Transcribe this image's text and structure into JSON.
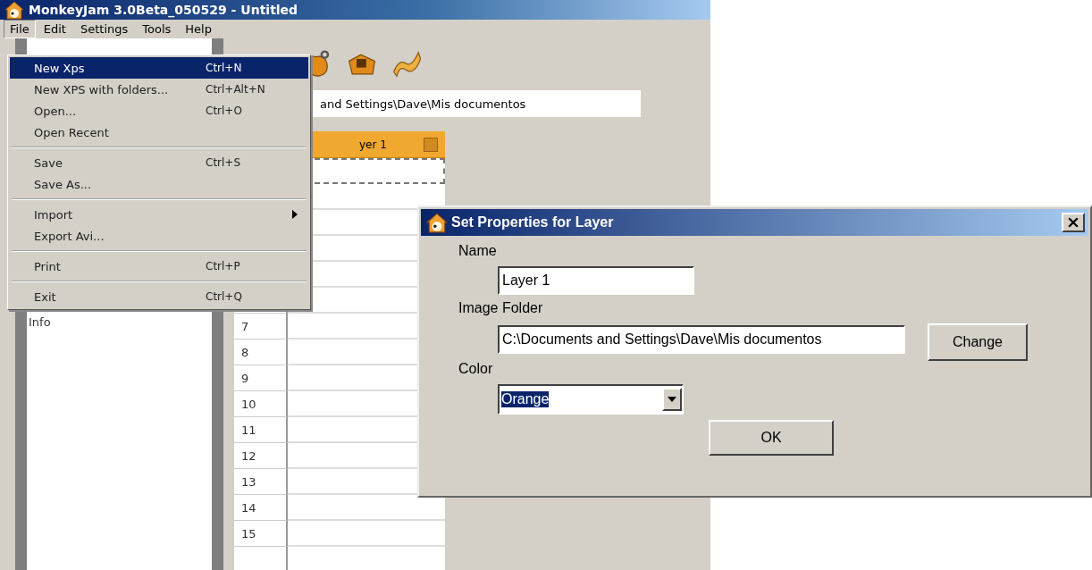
{
  "window": {
    "title": "MonkeyJam 3.0Beta_050529 - Untitled"
  },
  "menu_bar": [
    {
      "label": "File",
      "selected": true
    },
    {
      "label": "Edit",
      "selected": false
    },
    {
      "label": "Settings",
      "selected": false
    },
    {
      "label": "Tools",
      "selected": false
    },
    {
      "label": "Help",
      "selected": false
    }
  ],
  "file_menu": [
    {
      "kind": "item",
      "label": "New Xps",
      "shortcut": "Ctrl+N",
      "selected": true
    },
    {
      "kind": "item",
      "label": "New XPS with folders...",
      "shortcut": "Ctrl+Alt+N",
      "selected": false
    },
    {
      "kind": "item",
      "label": "Open...",
      "shortcut": "Ctrl+O",
      "selected": false
    },
    {
      "kind": "item",
      "label": "Open Recent",
      "selected": false
    },
    {
      "kind": "separator"
    },
    {
      "kind": "item",
      "label": "Save",
      "shortcut": "Ctrl+S",
      "selected": false
    },
    {
      "kind": "item",
      "label": "Save As...",
      "selected": false
    },
    {
      "kind": "separator"
    },
    {
      "kind": "submenu",
      "label": "Import",
      "selected": false
    },
    {
      "kind": "item",
      "label": "Export Avi...",
      "selected": false
    },
    {
      "kind": "separator"
    },
    {
      "kind": "item",
      "label": "Print",
      "shortcut": "Ctrl+P",
      "selected": false
    },
    {
      "kind": "separator"
    },
    {
      "kind": "item",
      "label": "Exit",
      "shortcut": "Ctrl+Q",
      "selected": false
    }
  ],
  "path_bar": {
    "text": "and Settings\\Dave\\Mis documentos"
  },
  "sidebar": {
    "items": [
      "Info"
    ]
  },
  "layer": {
    "title": "yer 1"
  },
  "frames": {
    "rows": [
      "7",
      "8",
      "9",
      "10",
      "11",
      "12",
      "13",
      "14",
      "15"
    ]
  },
  "dialog": {
    "title": "Set Properties for Layer",
    "name_label": "Name",
    "name_value": "Layer 1",
    "folder_label": "Image Folder",
    "folder_value": "C:\\Documents and Settings\\Dave\\Mis documentos",
    "change_button": "Change",
    "color_label": "Color",
    "color_value": "Orange",
    "ok_button": "OK"
  }
}
